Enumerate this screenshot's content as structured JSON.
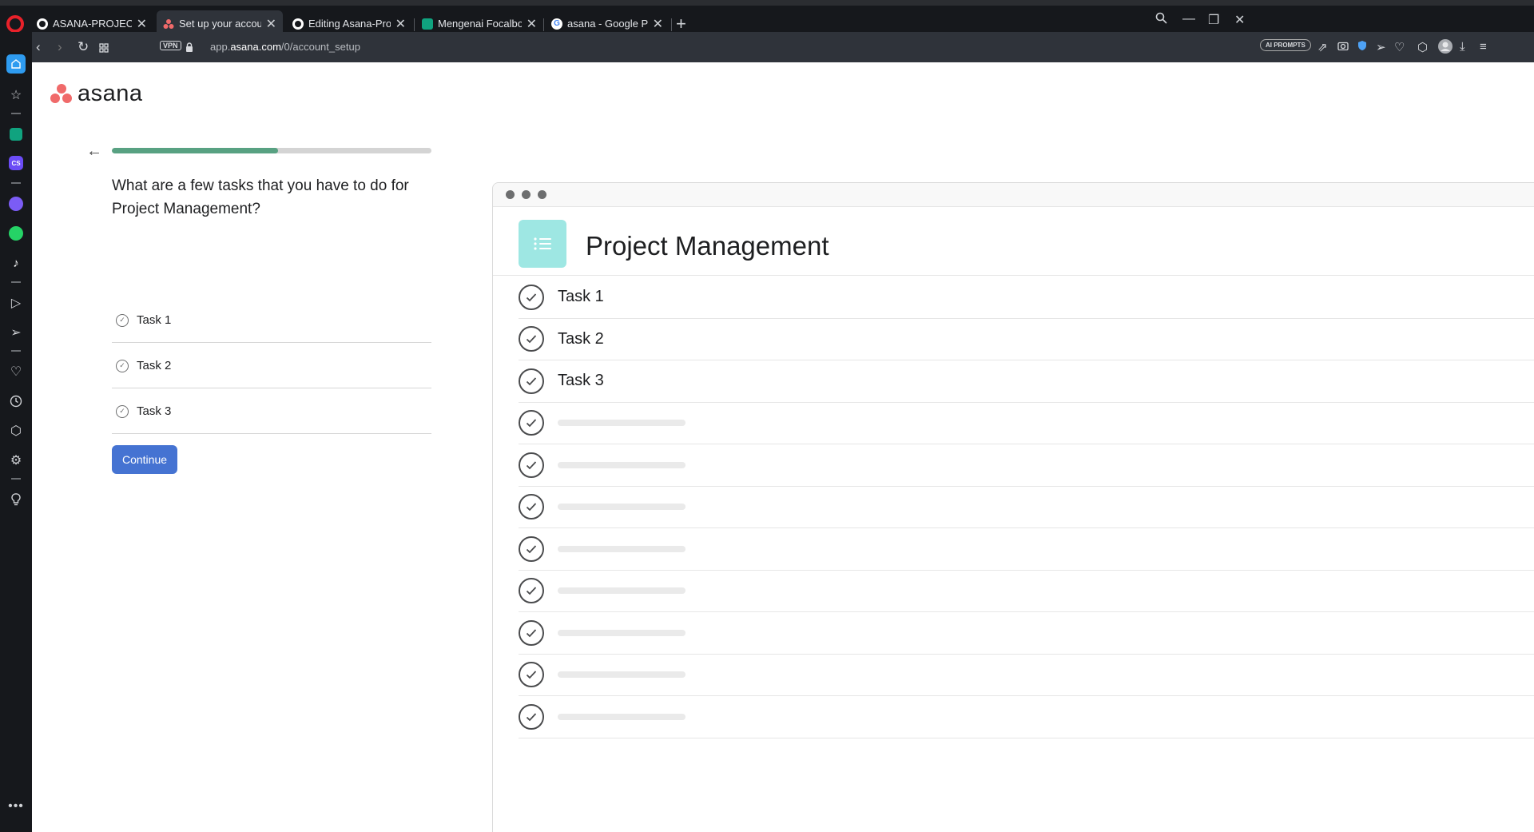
{
  "browser": {
    "tabs": [
      {
        "title": "ASANA-PROJECT-MANAGE",
        "favicon": "github-icon",
        "active": false
      },
      {
        "title": "Set up your account - Asana",
        "favicon": "asana-icon",
        "active": true
      },
      {
        "title": "Editing Asana-Project-Man",
        "favicon": "github-icon",
        "active": false
      },
      {
        "title": "Mengenai Focalboard.",
        "favicon": "chatgpt-icon",
        "active": false
      },
      {
        "title": "asana - Google Penelusuran",
        "favicon": "google-icon",
        "active": false
      }
    ],
    "vpn_label": "VPN",
    "url_prefix": "app.",
    "url_domain": "asana.com",
    "url_path": "/0/account_setup",
    "ai_prompts_label": "AI PROMPTS"
  },
  "page": {
    "logo_text": "asana",
    "progress_fraction": 0.52,
    "question": "What are a few tasks that you have to do for Project Management?",
    "tasks": [
      "Task 1",
      "Task 2",
      "Task 3"
    ],
    "continue_label": "Continue",
    "preview": {
      "project_title": "Project Management",
      "tasks": [
        "Task 1",
        "Task 2",
        "Task 3"
      ],
      "placeholder_rows": 8
    }
  },
  "colors": {
    "accent": "#4573d2",
    "progress": "#58a182",
    "asana_coral": "#f06a6a",
    "project_icon": "#9ee7e3"
  }
}
